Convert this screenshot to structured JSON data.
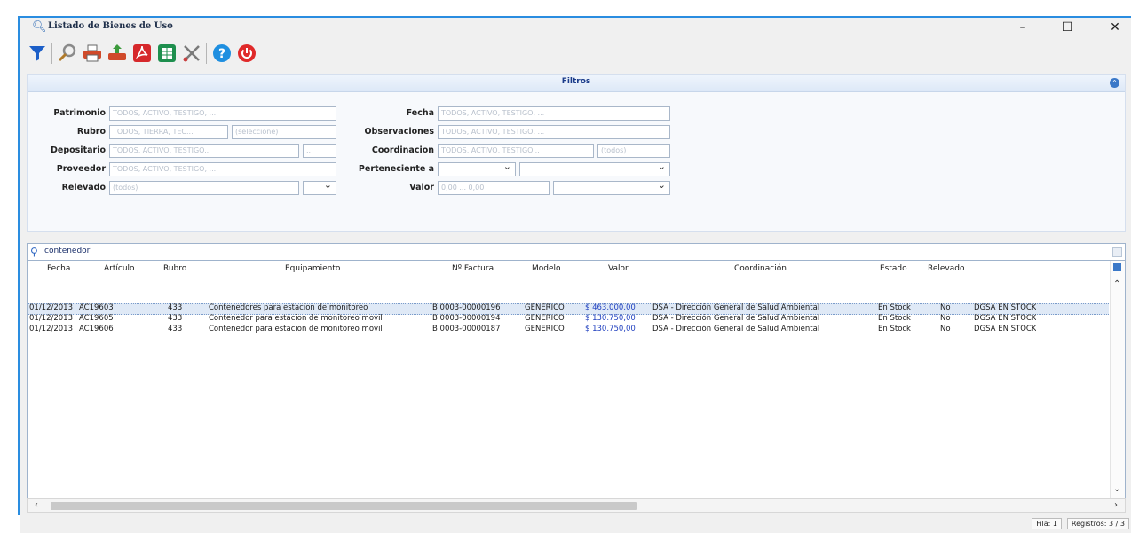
{
  "window": {
    "title": "Listado de Bienes de Uso",
    "min_label": "–",
    "max_label": "☐",
    "close_label": "✕"
  },
  "toolbar": {
    "buttons": [
      "filter-icon",
      "search-icon",
      "printer-icon",
      "print-export-icon",
      "pdf-icon",
      "excel-icon",
      "tools-icon",
      "help-icon",
      "power-icon"
    ]
  },
  "filters": {
    "title": "Filtros",
    "patrimonio": {
      "label": "Patrimonio",
      "value": "TODOS, ACTIVO, TESTIGO, ..."
    },
    "rubro": {
      "label": "Rubro",
      "value1": "TODOS, TIERRA, TEC...",
      "value2": "(seleccione)"
    },
    "depositario": {
      "label": "Depositario",
      "value1": "TODOS, ACTIVO, TESTIGO...",
      "value2": "..."
    },
    "proveedor": {
      "label": "Proveedor",
      "value": "TODOS, ACTIVO, TESTIGO, ..."
    },
    "relevado": {
      "label": "Relevado",
      "value": "(todos)",
      "select": ""
    },
    "fecha": {
      "label": "Fecha",
      "value": "TODOS, ACTIVO, TESTIGO, ..."
    },
    "observaciones": {
      "label": "Observaciones",
      "value": "TODOS, ACTIVO, TESTIGO, ..."
    },
    "coordinacion": {
      "label": "Coordinacion",
      "value1": "TODOS, ACTIVO, TESTIGO...",
      "value2": "(todos)"
    },
    "perteneciente": {
      "label": "Perteneciente a",
      "select1": "",
      "select2": ""
    },
    "valor": {
      "label": "Valor",
      "value": "0,00 ... 0,00",
      "select": ""
    }
  },
  "search": {
    "text": "contenedor"
  },
  "grid": {
    "headers": [
      "Fecha",
      "Artículo",
      "Rubro",
      "Equipamiento",
      "Nº Factura",
      "Modelo",
      "Valor",
      "Coordinación",
      "Estado",
      "Relevado"
    ],
    "rows": [
      {
        "fecha": "01/12/2013",
        "articulo": "AC19603",
        "rubro": "433",
        "equipamiento": "Contenedores para estacion de monitoreo",
        "factura": "B 0003-00000196",
        "modelo": "GENERICO",
        "valor": "$ 463.000,00",
        "coordinacion": "DSA - Dirección General de Salud Ambiental",
        "estado": "En Stock",
        "relevado": "No",
        "deposito": "DGSA EN STOCK"
      },
      {
        "fecha": "01/12/2013",
        "articulo": "AC19605",
        "rubro": "433",
        "equipamiento": "Contenedor para estacion de monitoreo movil",
        "factura": "B 0003-00000194",
        "modelo": "GENERICO",
        "valor": "$ 130.750,00",
        "coordinacion": "DSA - Dirección General de Salud Ambiental",
        "estado": "En Stock",
        "relevado": "No",
        "deposito": "DGSA EN STOCK"
      },
      {
        "fecha": "01/12/2013",
        "articulo": "AC19606",
        "rubro": "433",
        "equipamiento": "Contenedor para estacion de monitoreo movil",
        "factura": "B 0003-00000187",
        "modelo": "GENERICO",
        "valor": "$ 130.750,00",
        "coordinacion": "DSA - Dirección General de Salud Ambiental",
        "estado": "En Stock",
        "relevado": "No",
        "deposito": "DGSA EN STOCK"
      }
    ]
  },
  "status": {
    "fila": "Fila: 1",
    "registros": "Registros: 3 / 3"
  },
  "colors": {
    "accent": "#2a8de0",
    "selection": "#dfe9f6",
    "value_blue": "#1f3fbf"
  }
}
